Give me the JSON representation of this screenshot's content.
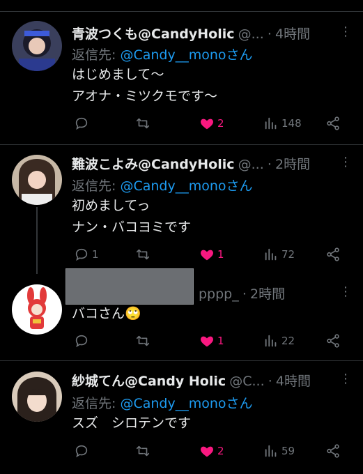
{
  "tweets": [
    {
      "name": "青波つくも@CandyHolic",
      "handle": "@...",
      "time": "4時間",
      "reply_prefix": "返信先: ",
      "reply_to": "@Candy__monoさん",
      "lines": [
        "はじめまして〜",
        "アオナ・ミツクモです〜"
      ],
      "replies": "",
      "retweets": "",
      "likes": "2",
      "views": "148"
    },
    {
      "name": "難波こよみ@CandyHolic",
      "handle": "@...",
      "time": "2時間",
      "reply_prefix": "返信先: ",
      "reply_to": "@Candy__monoさん",
      "lines": [
        "初めましてっ",
        "ナン・バコヨミです"
      ],
      "replies": "1",
      "retweets": "",
      "likes": "1",
      "views": "72"
    },
    {
      "name": "",
      "handle": "pppp_",
      "time": "2時間",
      "lines": [
        "バコさん🙄"
      ],
      "replies": "",
      "retweets": "",
      "likes": "1",
      "views": "22"
    },
    {
      "name": "紗城てん@Candy Holic",
      "handle": "@C...",
      "time": "4時間",
      "reply_prefix": "返信先: ",
      "reply_to": "@Candy__monoさん",
      "lines": [
        "スズ　シロテンです"
      ],
      "replies": "",
      "retweets": "",
      "likes": "2",
      "views": "59"
    }
  ],
  "ui": {
    "dot": "·",
    "more": "⋮"
  },
  "colors": {
    "like": "#f91880",
    "mention": "#1d9bf0",
    "muted": "#71767b"
  }
}
